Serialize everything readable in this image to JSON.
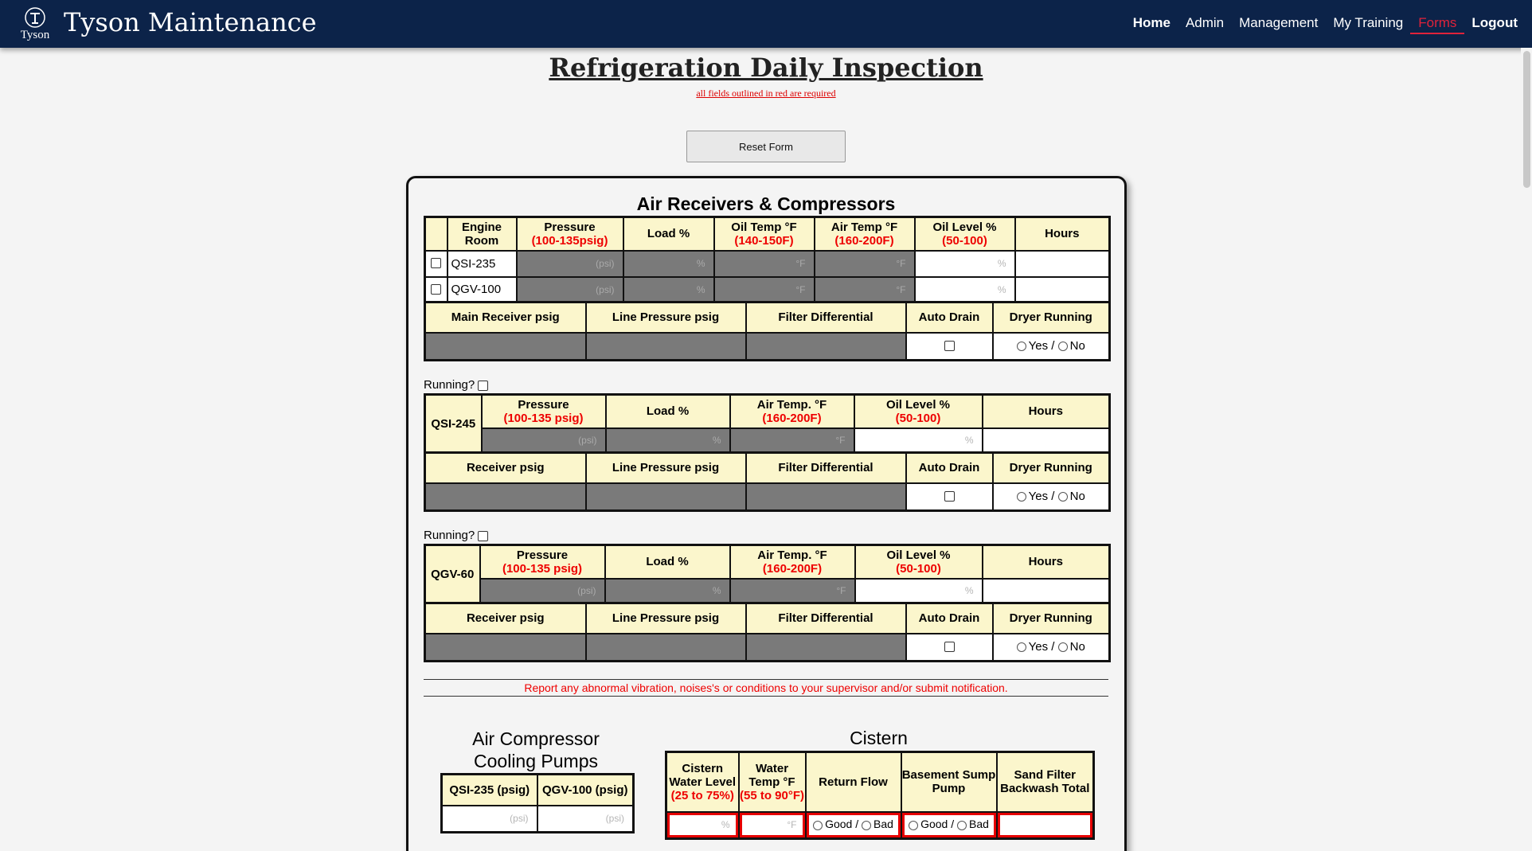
{
  "nav": {
    "logo_text": "Tyson",
    "brand": "Tyson Maintenance",
    "links": [
      {
        "label": "Home"
      },
      {
        "label": "Admin"
      },
      {
        "label": "Management"
      },
      {
        "label": "My Training"
      },
      {
        "label": "Forms"
      },
      {
        "label": "Logout"
      }
    ]
  },
  "page": {
    "title": "Refrigeration Daily Inspection",
    "required_note": "all fields outlined in red are required",
    "reset_button": "Reset Form"
  },
  "air_receivers": {
    "title": "Air Receivers & Compressors",
    "headers": {
      "engine_room": "Engine Room",
      "pressure": "Pressure",
      "pressure_range": "(100-135psig)",
      "load": "Load %",
      "oil_temp": "Oil Temp °F",
      "oil_temp_range": "(140-150F)",
      "air_temp": "Air Temp °F",
      "air_temp_range": "(160-200F)",
      "oil_level": "Oil Level %",
      "oil_level_range": "(50-100)",
      "hours": "Hours"
    },
    "rows": [
      {
        "name": "QSI-235"
      },
      {
        "name": "QGV-100"
      }
    ],
    "units": {
      "psi": "(psi)",
      "pct": "%",
      "degf": "°F"
    },
    "second_headers": {
      "main_receiver": "Main Receiver psig",
      "line_pressure": "Line Pressure psig",
      "filter_diff": "Filter Differential",
      "auto_drain": "Auto Drain",
      "dryer_running": "Dryer Running"
    },
    "yes": "Yes /",
    "no": "No"
  },
  "compressor_blocks": [
    {
      "running_label": "Running?",
      "name": "QSI-245",
      "pressure": "Pressure",
      "pressure_range": "(100-135 psig)",
      "load": "Load %",
      "air_temp": "Air Temp. °F",
      "air_temp_range": "(160-200F)",
      "oil_level": "Oil Level %",
      "oil_level_range": "(50-100)",
      "hours": "Hours",
      "receiver": "Receiver psig",
      "line_pressure": "Line Pressure psig",
      "filter_diff": "Filter Differential",
      "auto_drain": "Auto Drain",
      "dryer_running": "Dryer Running"
    },
    {
      "running_label": "Running?",
      "name": "QGV-60",
      "pressure": "Pressure",
      "pressure_range": "(100-135 psig)",
      "load": "Load %",
      "air_temp": "Air Temp. °F",
      "air_temp_range": "(160-200F)",
      "oil_level": "Oil Level %",
      "oil_level_range": "(50-100)",
      "hours": "Hours",
      "receiver": "Receiver psig",
      "line_pressure": "Line Pressure psig",
      "filter_diff": "Filter Differential",
      "auto_drain": "Auto Drain",
      "dryer_running": "Dryer Running"
    }
  ],
  "notice": "Report any abnormal vibration, noises's or conditions to your supervisor and/or submit notification.",
  "cooling_pumps": {
    "title_line1": "Air Compressor",
    "title_line2": "Cooling Pumps",
    "col1": "QSI-235 (psig)",
    "col2": "QGV-100 (psig)"
  },
  "cistern": {
    "title": "Cistern",
    "level": "Cistern Water Level",
    "level_range": "(25 to 75%)",
    "water_temp": "Water Temp °F",
    "water_temp_range": "(55 to 90°F)",
    "return_flow": "Return Flow",
    "basement_sump": "Basement Sump Pump",
    "sand_filter": "Sand Filter Backwash Total",
    "good": "Good /",
    "bad": "Bad"
  },
  "colors": {
    "navbar": "#0c2349",
    "header_cell": "#fbf6cc",
    "readonly_cell": "#7a7a7a",
    "required_red": "#e60000",
    "active_link": "#e0223a"
  }
}
